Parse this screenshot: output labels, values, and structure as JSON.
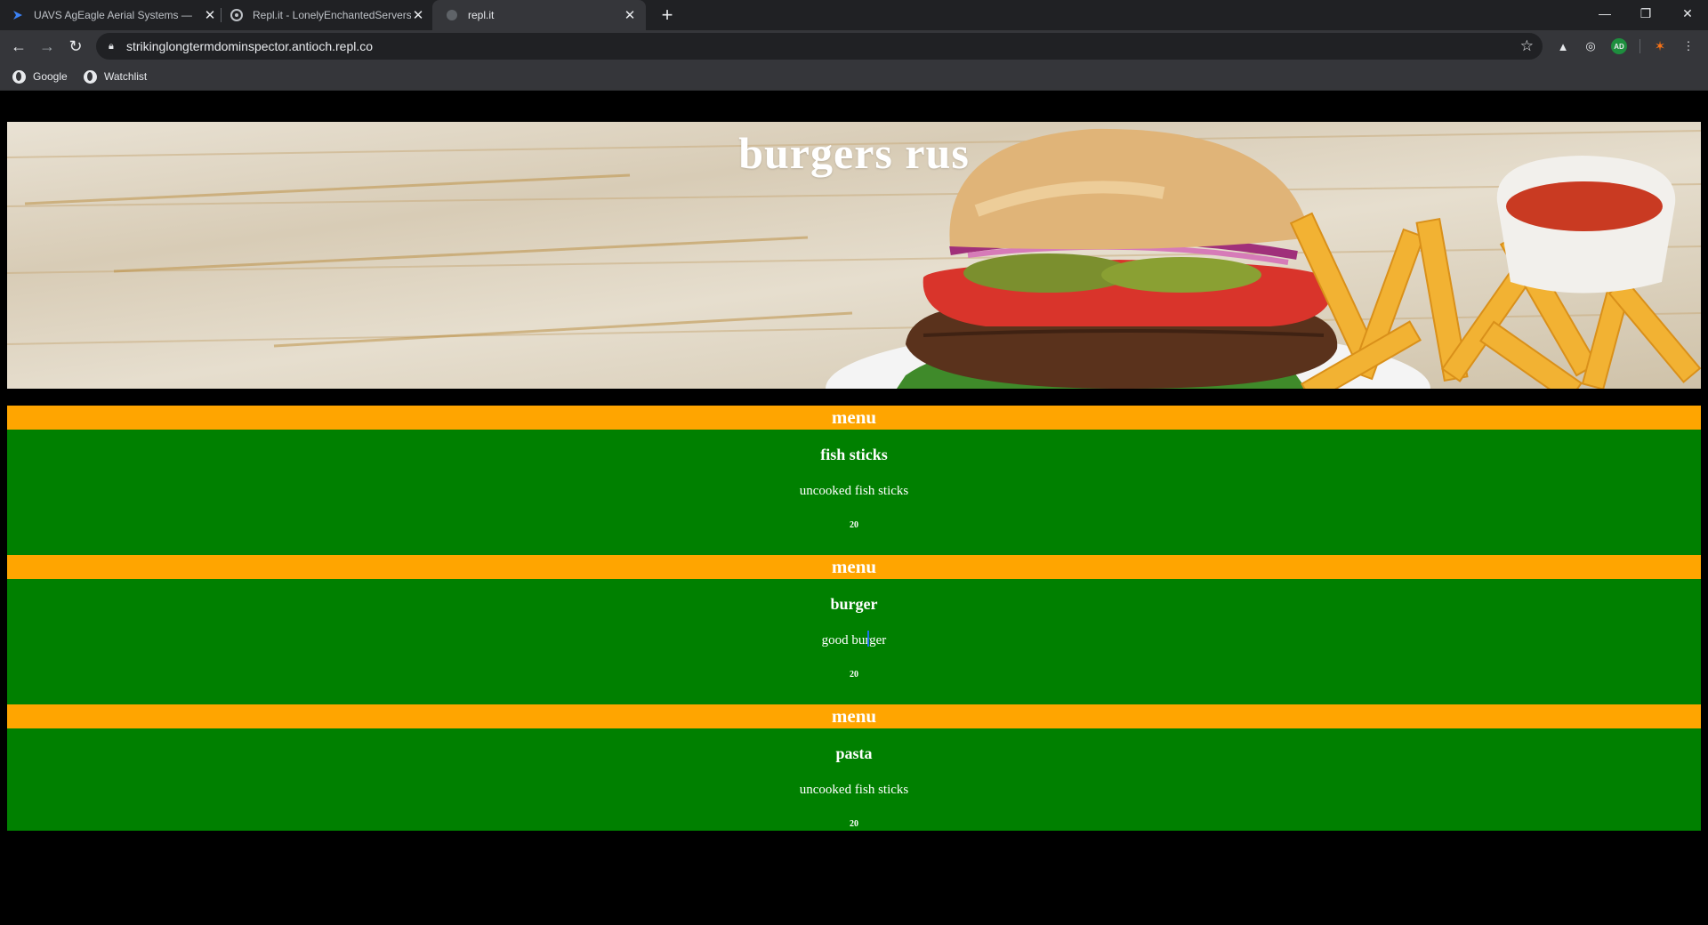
{
  "browser": {
    "tabs": [
      {
        "title": "UAVS AgEagle Aerial Systems —",
        "active": false
      },
      {
        "title": "Repl.it - LonelyEnchantedServers",
        "active": false
      },
      {
        "title": "repl.it",
        "active": true
      }
    ],
    "url": "strikinglongtermdominspector.antioch.repl.co",
    "bookmarks": [
      {
        "label": "Google"
      },
      {
        "label": "Watchlist"
      }
    ],
    "extension_badge": "AD"
  },
  "page": {
    "banner_title": "burgers rus",
    "sections": [
      {
        "heading": "menu",
        "name": "fish sticks",
        "description": "uncooked fish sticks",
        "price": "20"
      },
      {
        "heading": "menu",
        "name": "burger",
        "description": "good burger",
        "price": "20"
      },
      {
        "heading": "menu",
        "name": "pasta",
        "description": "uncooked fish sticks",
        "price": "20"
      }
    ]
  },
  "colors": {
    "header_orange": "#ffa500",
    "body_green": "#008000",
    "page_background": "#000000"
  }
}
